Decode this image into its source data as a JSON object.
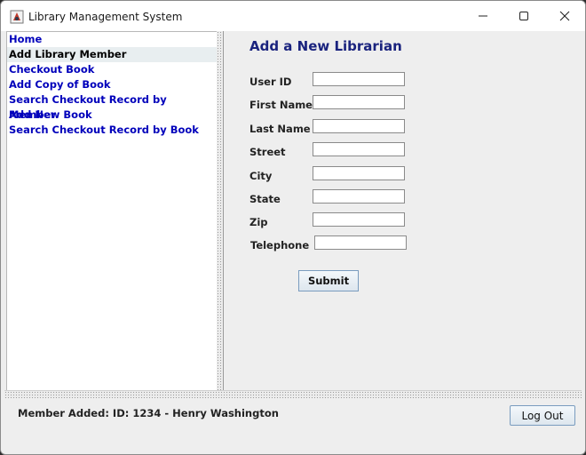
{
  "window": {
    "title": "Library Management System"
  },
  "nav": {
    "items": [
      {
        "label": "Home",
        "selected": false
      },
      {
        "label": "Add Library Member",
        "selected": true
      },
      {
        "label": "Checkout Book",
        "selected": false
      },
      {
        "label": "Add Copy of Book",
        "selected": false
      },
      {
        "label": "Search Checkout Record by Member",
        "selected": false
      },
      {
        "label": "Add New Book",
        "selected": false
      },
      {
        "label": "Search Checkout Record by Book",
        "selected": false
      }
    ]
  },
  "form": {
    "title": "Add a New Librarian",
    "fields": [
      {
        "label": "User ID",
        "value": ""
      },
      {
        "label": "First Name",
        "value": ""
      },
      {
        "label": "Last Name",
        "value": ""
      },
      {
        "label": "Street",
        "value": ""
      },
      {
        "label": "City",
        "value": ""
      },
      {
        "label": "State",
        "value": ""
      },
      {
        "label": "Zip",
        "value": ""
      },
      {
        "label": "Telephone",
        "value": ""
      }
    ],
    "submit_label": "Submit"
  },
  "status": {
    "message": "Member Added: ID: 1234 - Henry Washington"
  },
  "footer": {
    "logout_label": "Log Out"
  },
  "colors": {
    "nav_link": "#0000bb",
    "title_accent": "#1a237e"
  }
}
